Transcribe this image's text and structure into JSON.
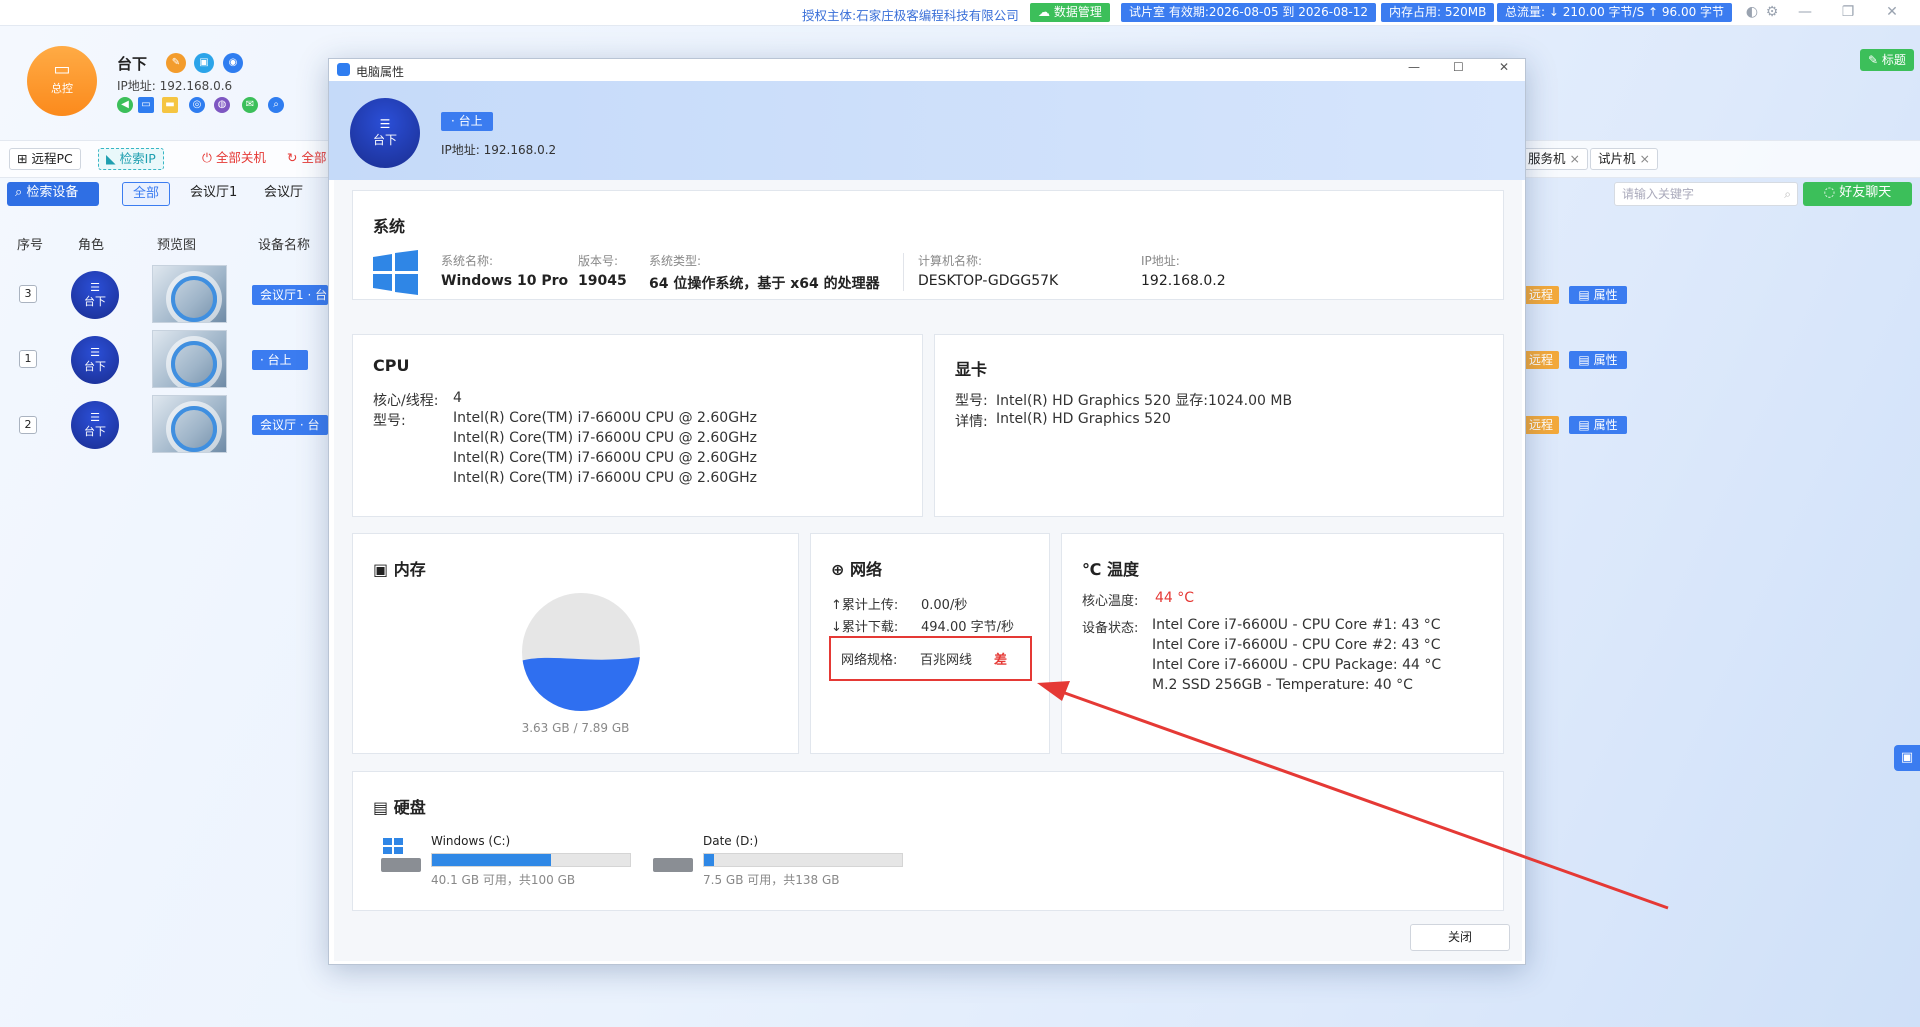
{
  "topbar": {
    "auth_label": "授权主体:",
    "auth_company": "石家庄极客编程科技有限公司",
    "data_mgmt": "数据管理",
    "trial": "试片室 有效期:2026-08-05 到 2026-08-12",
    "memory": "内存占用: 520MB",
    "traffic": "总流量: ↓ 210.00 字节/S ↑ 96.00 字节"
  },
  "app": {
    "console_label": "总控",
    "host_name": "台下",
    "host_ip": "IP地址: 192.168.0.6",
    "title_btn": "标题",
    "toolbar": {
      "remote_pc": "远程PC",
      "check_ip": "检索IP",
      "shutdown_all": "全部关机",
      "restart_all": "全部",
      "right_tab1": "服务机",
      "right_tab2": "试片机"
    },
    "search_device": "检索设备",
    "filters": [
      "全部",
      "会议厅1",
      "会议厅"
    ],
    "search_placeholder": "请输入关键字",
    "chat_btn": "好友聊天",
    "columns": {
      "index": "序号",
      "role": "角色",
      "preview": "预览图",
      "device": "设备名称"
    },
    "rows": [
      {
        "num": "3",
        "role": "台下",
        "device": "会议厅1 · 台"
      },
      {
        "num": "1",
        "role": "台下",
        "device": "· 台上"
      },
      {
        "num": "2",
        "role": "台下",
        "device": "会议厅 · 台"
      }
    ],
    "row_remote": "远程",
    "row_props": "属性"
  },
  "dialog": {
    "title": "电脑属性",
    "avatar_label": "台下",
    "tag": "· 台上",
    "ip": "IP地址: 192.168.0.2",
    "system": {
      "title": "系统",
      "name_label": "系统名称:",
      "name": "Windows 10 Pro",
      "version_label": "版本号:",
      "version": "19045",
      "type_label": "系统类型:",
      "type": "64 位操作系统，基于 x64 的处理器",
      "computer_label": "计算机名称:",
      "computer": "DESKTOP-GDGG57K",
      "ip_label": "IP地址:",
      "ip": "192.168.0.2"
    },
    "cpu": {
      "title": "CPU",
      "cores_label": "核心/线程:",
      "cores": "4",
      "model_label": "型号:",
      "models": [
        "Intel(R) Core(TM) i7-6600U CPU @ 2.60GHz",
        "Intel(R) Core(TM) i7-6600U CPU @ 2.60GHz",
        "Intel(R) Core(TM) i7-6600U CPU @ 2.60GHz",
        "Intel(R) Core(TM) i7-6600U CPU @ 2.60GHz"
      ]
    },
    "gpu": {
      "title": "显卡",
      "model_label": "型号:",
      "model": "Intel(R) HD Graphics 520 显存:1024.00 MB",
      "detail_label": "详情:",
      "detail": "Intel(R) HD Graphics 520"
    },
    "memory": {
      "title": "内存",
      "usage": "3.63 GB / 7.89 GB",
      "used_fraction": 0.46
    },
    "network": {
      "title": "网络",
      "upload_label": "↑累计上传:",
      "upload": "0.00/秒",
      "download_label": "↓累计下载:",
      "download": "494.00 字节/秒",
      "spec_label": "网络规格:",
      "spec": "百兆网线",
      "quality": "差"
    },
    "temperature": {
      "title": "温度",
      "core_label": "核心温度:",
      "core": "44 °C",
      "status_label": "设备状态:",
      "sensors": [
        "Intel Core i7-6600U - CPU Core #1: 43 °C",
        "Intel Core i7-6600U - CPU Core #2: 43 °C",
        "Intel Core i7-6600U - CPU Package: 44 °C",
        "M.2 SSD 256GB - Temperature: 40 °C"
      ]
    },
    "disk": {
      "title": "硬盘",
      "drives": [
        {
          "name": "Windows (C:)",
          "info": "40.1 GB 可用，共100 GB",
          "used_fraction": 0.6
        },
        {
          "name": "Date (D:)",
          "info": "7.5 GB 可用，共138 GB",
          "used_fraction": 0.05
        }
      ]
    },
    "close_label": "关闭"
  },
  "colors": {
    "accent": "#3b7cf0",
    "orange": "#fb8a1c",
    "warn": "#e53935",
    "green": "#3cbf5a"
  }
}
